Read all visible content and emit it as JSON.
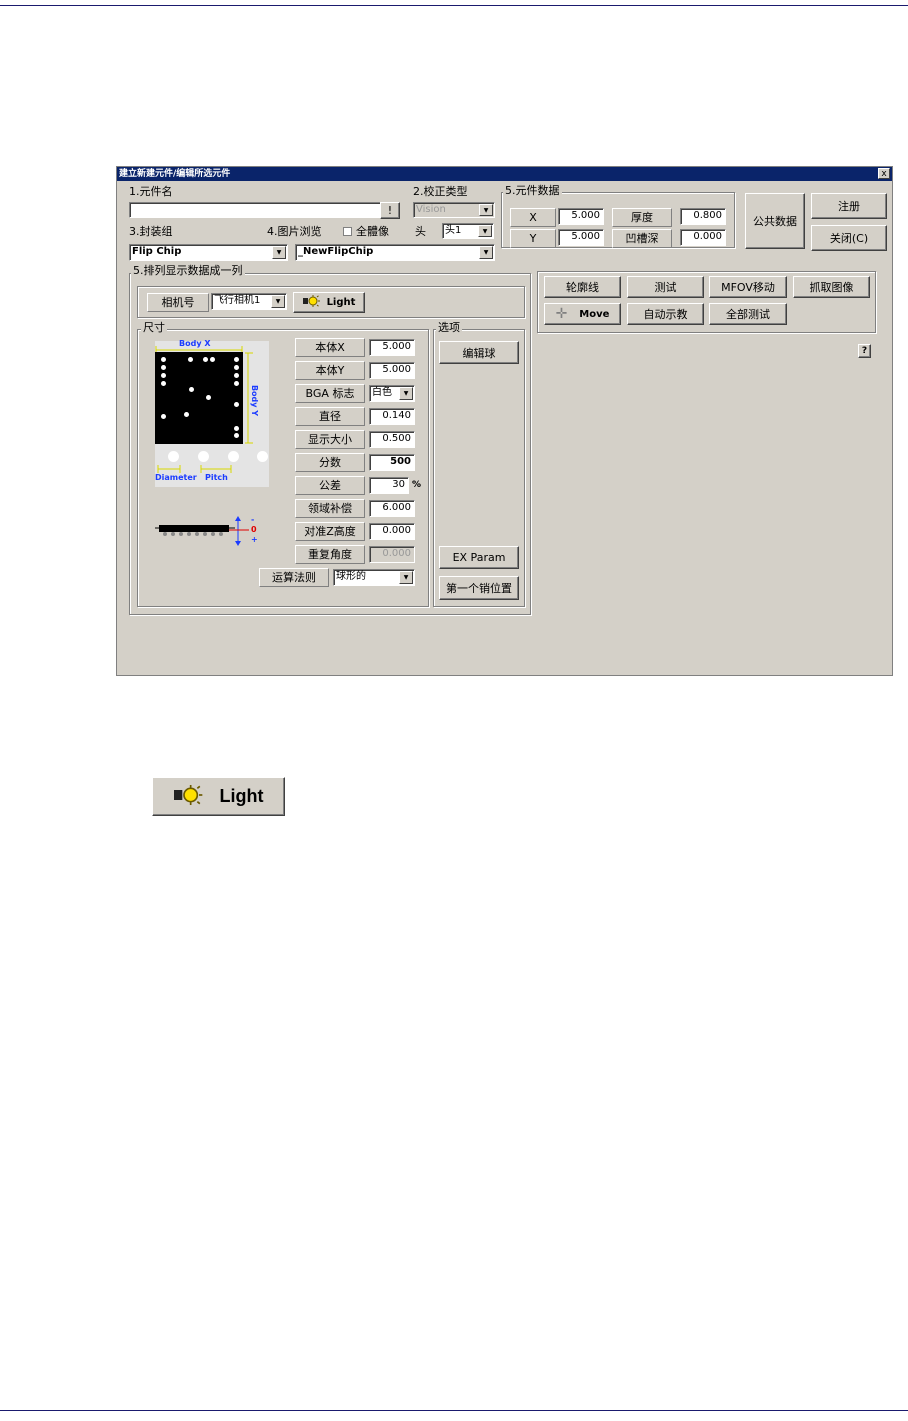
{
  "window": {
    "title": "建立新建元件/编辑所选元件",
    "close": "x"
  },
  "part_name": {
    "label": "1.元件名",
    "value": "",
    "btn": "!"
  },
  "correction_type": {
    "label": "2.校正类型",
    "value": "Vision"
  },
  "package": {
    "label": "3.封装组",
    "value": "Flip Chip"
  },
  "image_browse": {
    "label": "4.图片浏览",
    "mirror": "全體像",
    "head_label": "头",
    "head_value": "头1",
    "file": "_NewFlipChip"
  },
  "part_data": {
    "label": "5.元件数据",
    "x_label": "X",
    "x_value": "5.000",
    "y_label": "Y",
    "y_value": "5.000",
    "thick_label": "厚度",
    "thick_value": "0.800",
    "recess_label": "凹槽深",
    "recess_value": "0.000"
  },
  "buttons": {
    "common_data": "公共数据",
    "register": "注册",
    "close": "关闭(C)"
  },
  "array_group": {
    "label": "5.排列显示数据成一列",
    "camera_label": "相机号",
    "camera_value": "飞行相机1",
    "light": "Light"
  },
  "size_group": {
    "label": "尺寸",
    "body_x": "Body X",
    "body_y": "Body Y",
    "diameter": "Diameter",
    "pitch": "Pitch",
    "side_minus": "-",
    "side_zero": "0",
    "side_plus": "+",
    "rows": [
      {
        "label": "本体X",
        "value": "5.000"
      },
      {
        "label": "本体Y",
        "value": "5.000"
      },
      {
        "label": "BGA 标志",
        "value": "白色"
      },
      {
        "label": "直径",
        "value": "0.140"
      },
      {
        "label": "显示大小",
        "value": "0.500"
      },
      {
        "label": "分数",
        "value": "500"
      },
      {
        "label": "公差",
        "value": "30",
        "unit": "%"
      },
      {
        "label": "领域补偿",
        "value": "6.000"
      },
      {
        "label": "对准Z高度",
        "value": "0.000"
      },
      {
        "label": "重复角度",
        "value": "0.000"
      }
    ],
    "algo_label": "运算法则",
    "algo_value": "球形的"
  },
  "options_group": {
    "label": "选项",
    "edit_ball": "编辑球",
    "ex_param": "EX Param",
    "first_pin": "第一个销位置"
  },
  "actions": {
    "contour": "轮廓线",
    "test": "测试",
    "mfov": "MFOV移动",
    "grab": "抓取图像",
    "move": "Move",
    "auto_teach": "自动示教",
    "all_test": "全部测试"
  },
  "help": "?",
  "light_closeup": "Light"
}
